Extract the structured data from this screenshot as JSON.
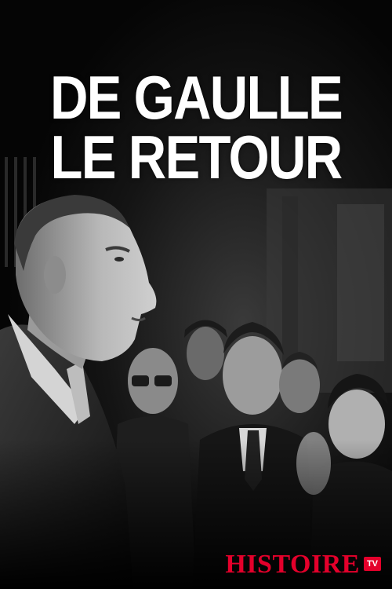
{
  "poster": {
    "title_line1": "DE GAULLE",
    "title_line2": "LE RETOUR"
  },
  "logo": {
    "text": "HISTOIRE",
    "badge": "TV",
    "color": "#e4002b"
  }
}
